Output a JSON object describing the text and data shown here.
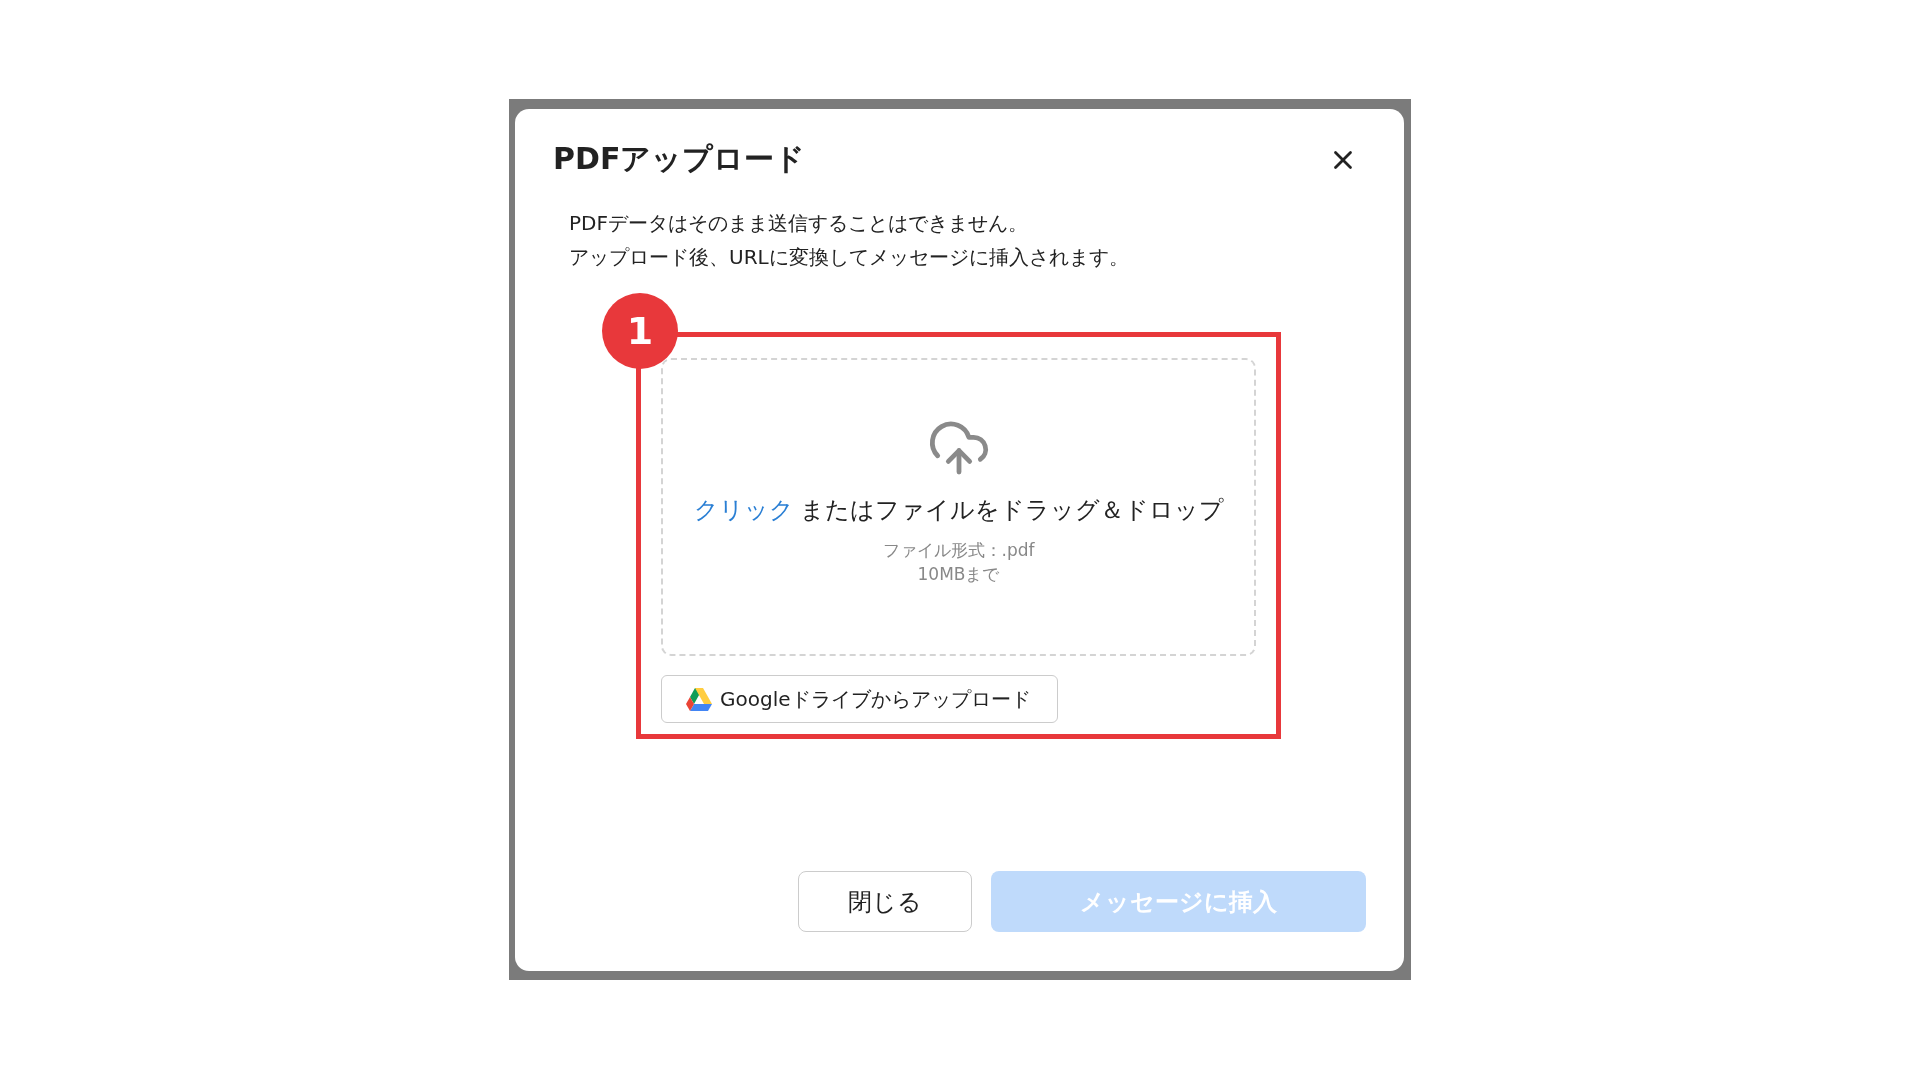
{
  "dialog": {
    "title": "PDFアップロード"
  },
  "description": [
    "PDFデータはそのまま送信することはできません。",
    "アップロード後、URLに変換してメッセージに挿入されます。"
  ],
  "annotation": {
    "badge": "1"
  },
  "dropzone": {
    "link": "クリック",
    "text": "またはファイルをドラッグ＆ドロップ",
    "format": "ファイル形式：.pdf",
    "size_limit": "10MBまで"
  },
  "drive_button": {
    "label": "Googleドライブからアップロード"
  },
  "buttons": [
    {
      "label": "閉じる",
      "kind": "secondary",
      "disabled": false
    },
    {
      "label": "メッセージに挿入",
      "kind": "primary",
      "disabled": true
    }
  ]
}
